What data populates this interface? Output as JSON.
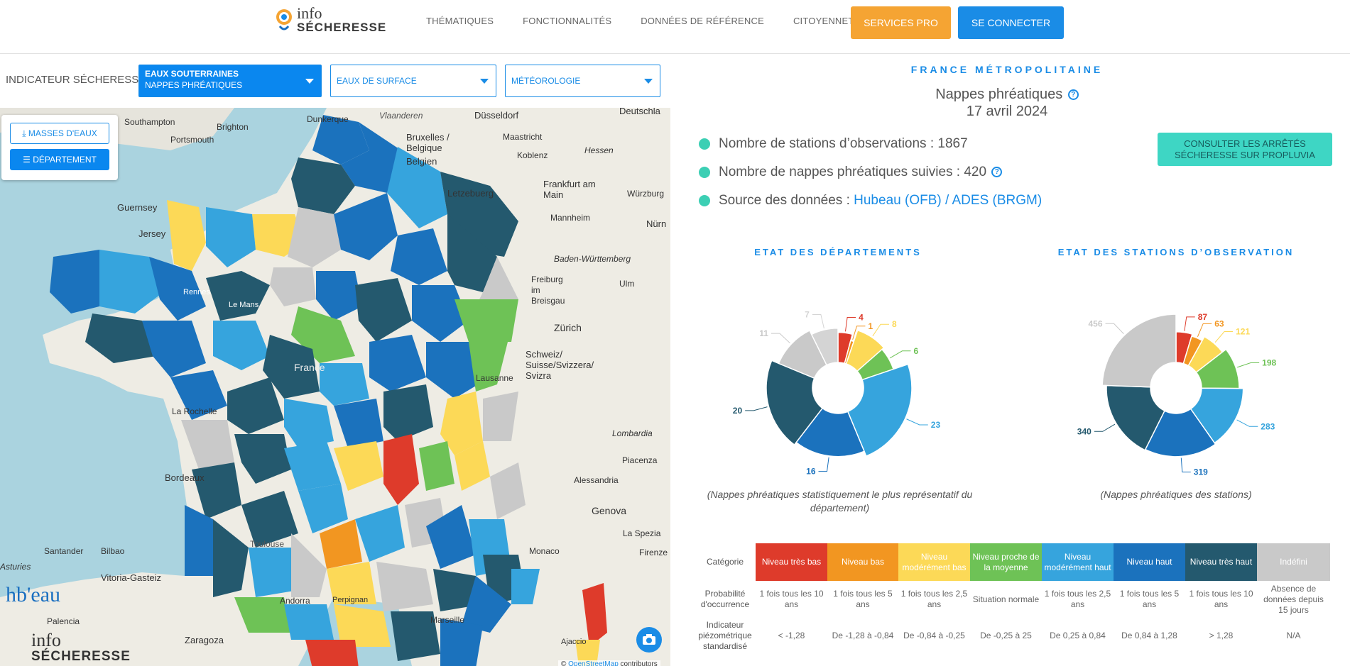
{
  "header": {
    "logo": {
      "line1": "info",
      "line2": "SÉCHERESSE"
    },
    "nav": [
      "THÉMATIQUES",
      "FONCTIONNALITÉS",
      "DONNÉES DE RÉFÉRENCE",
      "CITOYENNETÉ"
    ],
    "services_pro": "SERVICES PRO",
    "se_connecter": "SE CONNECTER"
  },
  "indicator": {
    "label": "INDICATEUR SÉCHERESSE :",
    "selects": [
      {
        "line1": "EAUX SOUTERRAINES",
        "line2": "NAPPES PHRÉATIQUES"
      },
      {
        "line1": "EAUX DE SURFACE"
      },
      {
        "line1": "MÉTÉOROLOGIE"
      }
    ]
  },
  "map": {
    "masses_button": "MASSES D'EAUX",
    "departement_button": "DÉPARTEMENT",
    "attribution_prefix": "©",
    "attribution_link": "OpenStreetMap",
    "attribution_suffix": "contributors",
    "hubeau_logo": "hb'eau",
    "logo": {
      "line1": "info",
      "line2": "SÉCHERESSE"
    },
    "labels": [
      "Southampton",
      "Brighton",
      "Portsmouth",
      "Guernsey",
      "Jersey",
      "Düsseldorf",
      "Deutschla",
      "Koblenz",
      "Hessen",
      "Frankfurt am Main",
      "Würzburg",
      "Mannheim",
      "Nürn",
      "Letzebuerg",
      "Baden-Württemberg",
      "Ulm",
      "Freiburg im Breisgau",
      "Zürich",
      "Schweiz/ Suisse/Svizzera/ Svizra",
      "Lausanne",
      "Lombardia",
      "Piacenza",
      "Alessandria",
      "Genova",
      "La Spezia",
      "Firenze",
      "Monaco",
      "Bordeaux",
      "La Rochelle",
      "Santander",
      "Bilbao",
      "Vitoria-Gasteiz",
      "Palencia",
      "Zaragoza",
      "Asturies",
      "Le Mans",
      "Rennes",
      "Marseille",
      "Toulouse",
      "Perpignan",
      "Andorra",
      "Ajaccio",
      "Vlaanderen",
      "Dunkerque",
      "Bruxelles / Belgique",
      "Maastricht",
      "Belgien",
      "France"
    ]
  },
  "panel": {
    "region": "FRANCE MÉTROPOLITAINE",
    "title": "Nappes phréatiques",
    "date": "17 avril 2024",
    "help": "?",
    "stats": [
      {
        "text": "Nombre de stations d’observations : 1867"
      },
      {
        "text": "Nombre de nappes phréatiques suivies : 420"
      }
    ],
    "source": {
      "prefix": "Source des données : ",
      "l1": "Hubeau",
      "p1": "(",
      "l2": "OFB",
      "p2": ") / ",
      "l3": "ADES",
      "p3": " (",
      "l4": "BRGM",
      "p4": ")"
    },
    "propluvia_button_l1": "CONSULTER LES ARRÊTÉS",
    "propluvia_button_l2": "SÉCHERESSE SUR PROPLUVIA"
  },
  "chart_data": [
    {
      "type": "pie",
      "title": "ETAT DES DÉPARTEMENTS",
      "caption": "(Nappes phréatiques statistiquement le plus représentatif du département)",
      "categories": [
        "Niveau très bas",
        "Niveau bas",
        "Niveau modérément bas",
        "Niveau proche de la moyenne",
        "Niveau modérément haut",
        "Niveau haut",
        "Niveau très haut",
        "Indéfini"
      ],
      "values": [
        4,
        1,
        8,
        6,
        23,
        16,
        20,
        11,
        7
      ]
    },
    {
      "type": "pie",
      "title": "ETAT DES STATIONS D’OBSERVATION",
      "caption": "(Nappes phréatiques des stations)",
      "categories": [
        "Niveau très bas",
        "Niveau bas",
        "Niveau modérément bas",
        "Niveau proche de la moyenne",
        "Niveau modérément haut",
        "Niveau haut",
        "Niveau très haut",
        "Indéfini"
      ],
      "values": [
        87,
        63,
        121,
        198,
        283,
        319,
        340,
        456
      ]
    }
  ],
  "legend": {
    "row_heads": [
      "Catégorie",
      "Probabilité d'occurrence",
      "Indicateur piézométrique standardisé"
    ],
    "categories": [
      {
        "label": "Niveau très bas",
        "prob": "1 fois tous les 10 ans",
        "ips": "< -1,28",
        "color": "#de3b2b",
        "text": "#ffffff"
      },
      {
        "label": "Niveau bas",
        "prob": "1 fois tous les 5 ans",
        "ips": "De -1,28 à -0,84",
        "color": "#f29621",
        "text": "#ffffff"
      },
      {
        "label": "Niveau modérément bas",
        "prob": "1 fois tous les 2,5 ans",
        "ips": "De -0,84 à -0,25",
        "color": "#fcd957",
        "text": "#ffffff"
      },
      {
        "label": "Niveau proche de la moyenne",
        "prob": "Situation normale",
        "ips": "De -0,25 à 25",
        "color": "#6ec256",
        "text": "#ffffff"
      },
      {
        "label": "Niveau modérément haut",
        "prob": "1 fois tous les 2,5 ans",
        "ips": "De 0,25 à 0,84",
        "color": "#36a4dd",
        "text": "#ffffff"
      },
      {
        "label": "Niveau haut",
        "prob": "1 fois tous les 5 ans",
        "ips": "De 0,84 à 1,28",
        "color": "#1b72bd",
        "text": "#ffffff"
      },
      {
        "label": "Niveau très haut",
        "prob": "1 fois tous les 10 ans",
        "ips": "> 1,28",
        "color": "#24596e",
        "text": "#ffffff"
      },
      {
        "label": "Indéfini",
        "prob": "Absence de données depuis 15 jours",
        "ips": "N/A",
        "color": "#c9c9c9",
        "text": "#ffffff"
      }
    ]
  }
}
